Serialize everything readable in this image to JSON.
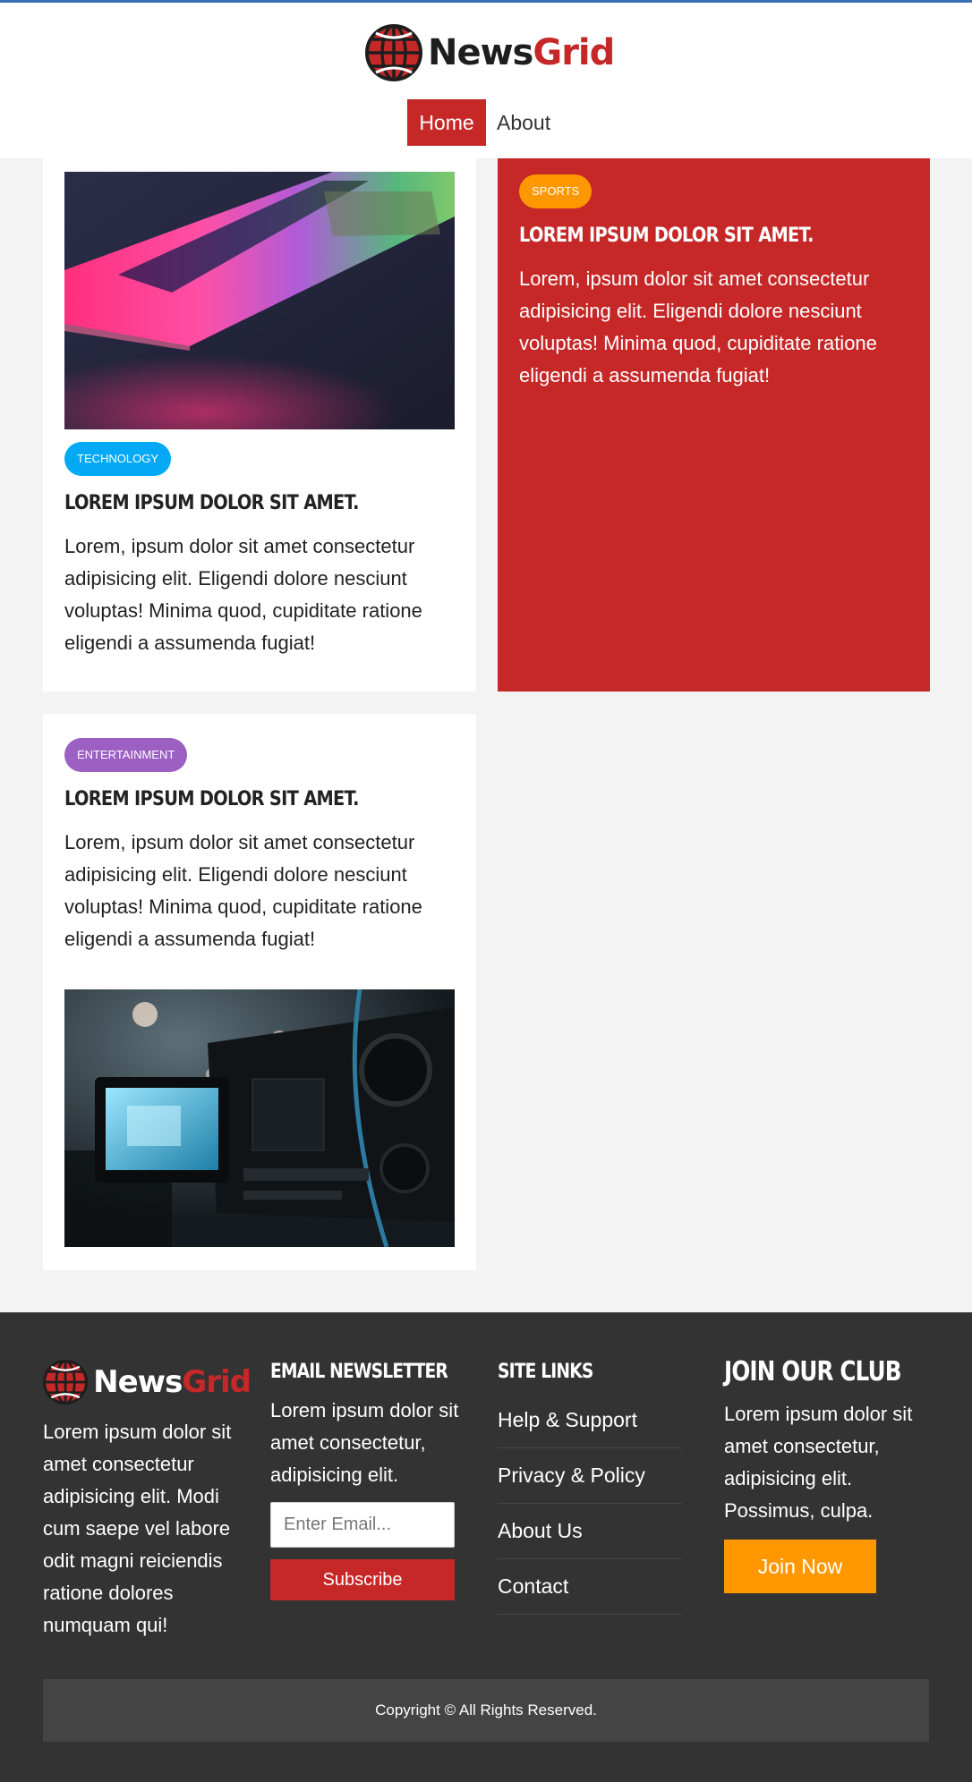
{
  "brand": {
    "name_part1": "News",
    "name_part2": "Grid"
  },
  "nav": {
    "items": [
      {
        "label": "Home"
      },
      {
        "label": "About"
      }
    ]
  },
  "articles": [
    {
      "category": "Technology",
      "title": "Lorem ipsum dolor sit amet.",
      "body": "Lorem, ipsum dolor sit amet consectetur adipisicing elit. Eligendi dolore nesciunt voluptas! Minima quod, cupiditate ratione eligendi a assumenda fugiat!",
      "image": "laptop-keyboard-image"
    },
    {
      "category": "Sports",
      "title": "Lorem ipsum dolor sit amet.",
      "body": "Lorem, ipsum dolor sit amet consectetur adipisicing elit. Eligendi dolore nesciunt voluptas! Minima quod, cupiditate ratione eligendi a assumenda fugiat!"
    },
    {
      "category": "Entertainment",
      "title": "Lorem ipsum dolor sit amet.",
      "body": "Lorem, ipsum dolor sit amet consectetur adipisicing elit. Eligendi dolore nesciunt voluptas! Minima quod, cupiditate ratione eligendi a assumenda fugiat!",
      "image": "video-camera-image"
    }
  ],
  "footer": {
    "about_text": "Lorem ipsum dolor sit amet consectetur adipisicing elit. Modi cum saepe vel labore odit magni reiciendis ratione dolores numquam qui!",
    "newsletter": {
      "heading": "Email Newsletter",
      "text": "Lorem ipsum dolor sit amet consectetur, adipisicing elit.",
      "placeholder": "Enter Email...",
      "button": "Subscribe"
    },
    "site_links": {
      "heading": "Site Links",
      "items": [
        "Help & Support",
        "Privacy & Policy",
        "About Us",
        "Contact"
      ]
    },
    "club": {
      "heading": "Join Our Club",
      "text": "Lorem ipsum dolor sit amet consectetur, adipisicing elit. Possimus, culpa.",
      "button": "Join Now"
    },
    "copyright": "Copyright © All Rights Reserved."
  },
  "colors": {
    "brand_red": "#c62828",
    "tech_badge": "#03a9f4",
    "sports_badge": "#ff9800",
    "entertainment_badge": "#9c5fc2",
    "footer_bg": "#333333",
    "join_button": "#ff9800"
  }
}
